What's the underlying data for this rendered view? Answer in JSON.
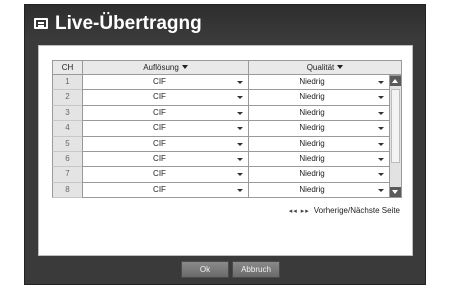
{
  "window": {
    "title": "Live-Übertragng"
  },
  "table": {
    "columns": [
      {
        "label": "CH"
      },
      {
        "label": "Auflösung"
      },
      {
        "label": "Qualität"
      }
    ],
    "rows": [
      {
        "ch": "1",
        "resolution": "CIF",
        "quality": "Niedrig"
      },
      {
        "ch": "2",
        "resolution": "CIF",
        "quality": "Niedrig"
      },
      {
        "ch": "3",
        "resolution": "CIF",
        "quality": "Niedrig"
      },
      {
        "ch": "4",
        "resolution": "CIF",
        "quality": "Niedrig"
      },
      {
        "ch": "5",
        "resolution": "CIF",
        "quality": "Niedrig"
      },
      {
        "ch": "6",
        "resolution": "CIF",
        "quality": "Niedrig"
      },
      {
        "ch": "7",
        "resolution": "CIF",
        "quality": "Niedrig"
      },
      {
        "ch": "8",
        "resolution": "CIF",
        "quality": "Niedrig"
      }
    ]
  },
  "pager": {
    "arrows": "◂◂ ▸▸",
    "label": "Vorherige/Nächste Seite"
  },
  "buttons": {
    "ok": "Ok",
    "cancel": "Abbruch"
  },
  "colors": {
    "frame": "#3a3a3a",
    "panel": "#ffffff",
    "header_cell": "#e9e9e9",
    "button": "#7a7a7a"
  }
}
